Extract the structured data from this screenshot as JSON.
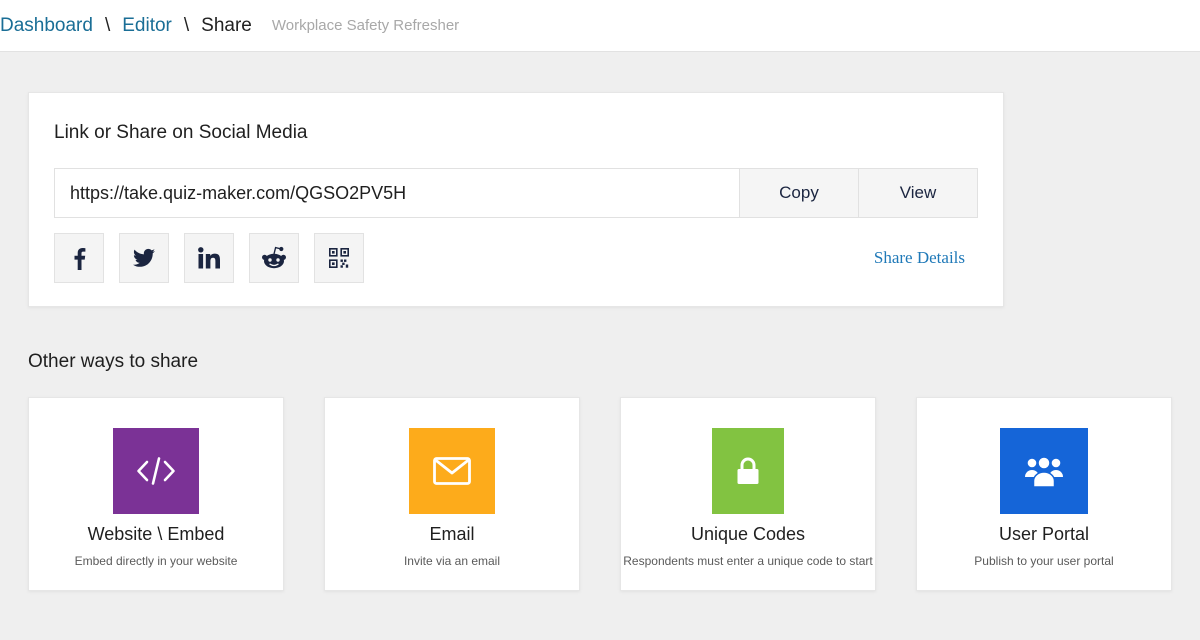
{
  "breadcrumb": {
    "dashboard": "Dashboard",
    "editor": "Editor",
    "current": "Share",
    "separator": "\\",
    "quiz_title": "Workplace Safety Refresher"
  },
  "social_card": {
    "title": "Link or Share on Social Media",
    "link_value": "https://take.quiz-maker.com/QGSO2PV5H",
    "copy_label": "Copy",
    "view_label": "View",
    "share_details_label": "Share Details",
    "social_icons": [
      "facebook-icon",
      "twitter-icon",
      "linkedin-icon",
      "reddit-icon",
      "qr-code-icon"
    ],
    "icon_color": "#1b2540"
  },
  "other_ways": {
    "title": "Other ways to share",
    "options": [
      {
        "name": "Website \\ Embed",
        "description": "Embed directly in your website",
        "icon": "code-icon",
        "color": "#7b3296"
      },
      {
        "name": "Email",
        "description": "Invite via an email",
        "icon": "envelope-icon",
        "color": "#fdab1b"
      },
      {
        "name": "Unique Codes",
        "description": "Respondents must enter a unique code to start",
        "icon": "lock-icon",
        "color": "#82c341"
      },
      {
        "name": "User Portal",
        "description": "Publish to your user portal",
        "icon": "users-icon",
        "color": "#1565d8"
      }
    ]
  }
}
